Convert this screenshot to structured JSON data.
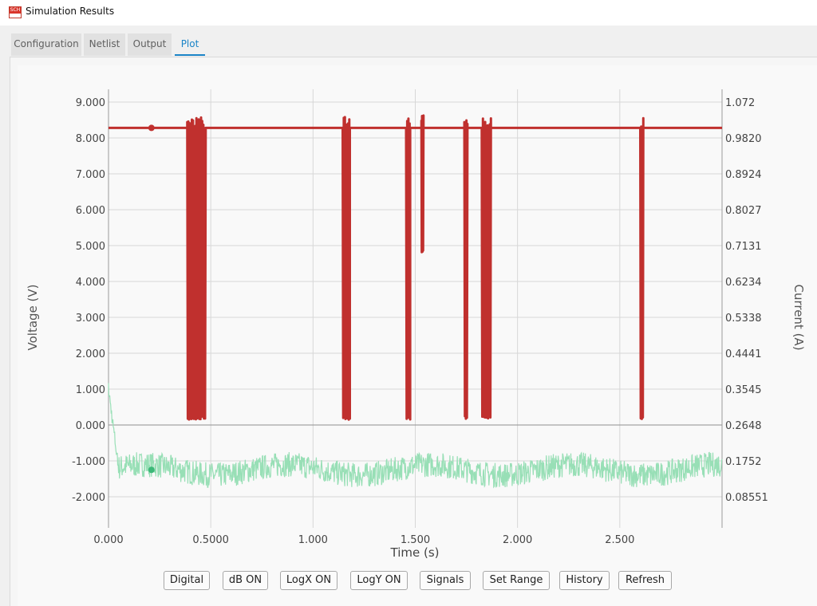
{
  "window": {
    "title": "Simulation Results",
    "icon": "sch-app-icon",
    "icon_text": "SCH"
  },
  "tabs": [
    {
      "label": "Configuration",
      "active": false
    },
    {
      "label": "Netlist",
      "active": false
    },
    {
      "label": "Output",
      "active": false
    },
    {
      "label": "Plot",
      "active": true
    }
  ],
  "chart_data": {
    "type": "line",
    "xlabel": "Time (s)",
    "ylabel_left": "Voltage (V)",
    "ylabel_right": "Current (A)",
    "xlim": [
      0,
      3.0
    ],
    "ylim_left": [
      -2.9,
      9.3
    ],
    "x_ticks": [
      "0.000",
      "0.5000",
      "1.000",
      "1.500",
      "2.000",
      "2.500"
    ],
    "x_tick_values": [
      0,
      0.5,
      1.0,
      1.5,
      2.0,
      2.5
    ],
    "y_ticks_left": [
      "9.000",
      "8.000",
      "7.000",
      "6.000",
      "5.000",
      "4.000",
      "3.000",
      "2.000",
      "1.000",
      "0.000",
      "-1.000",
      "-2.000"
    ],
    "y_tick_values_left": [
      9,
      8,
      7,
      6,
      5,
      4,
      3,
      2,
      1,
      0,
      -1,
      -2
    ],
    "y_ticks_right": [
      "1.072",
      "0.9820",
      "0.8924",
      "0.8027",
      "0.7131",
      "0.6234",
      "0.5338",
      "0.4441",
      "0.3545",
      "0.2648",
      "0.1752",
      "0.08551"
    ],
    "grid": true,
    "series": [
      {
        "color": "#c0302e",
        "axis": "left",
        "baseline": 8.28,
        "low": 0.15,
        "marker_x": 0.21,
        "dips": [
          {
            "start": 0.385,
            "end": 0.475,
            "low": 0.15
          },
          {
            "start": 1.145,
            "end": 1.18,
            "low": 0.15
          },
          {
            "start": 1.455,
            "end": 1.475,
            "low": 0.15
          },
          {
            "start": 1.53,
            "end": 1.54,
            "low": 4.8
          },
          {
            "start": 1.74,
            "end": 1.755,
            "low": 0.15
          },
          {
            "start": 1.825,
            "end": 1.87,
            "low": 0.15
          },
          {
            "start": 2.6,
            "end": 2.615,
            "low": 0.15
          }
        ]
      },
      {
        "color": "#98dfb6",
        "axis": "right",
        "mean": -1.25,
        "noise": 0.35,
        "start_value": 1.0,
        "marker_x": 0.21
      }
    ]
  },
  "buttons": [
    "Digital",
    "dB ON",
    "LogX ON",
    "LogY ON",
    "Signals",
    "Set Range",
    "History",
    "Refresh"
  ]
}
